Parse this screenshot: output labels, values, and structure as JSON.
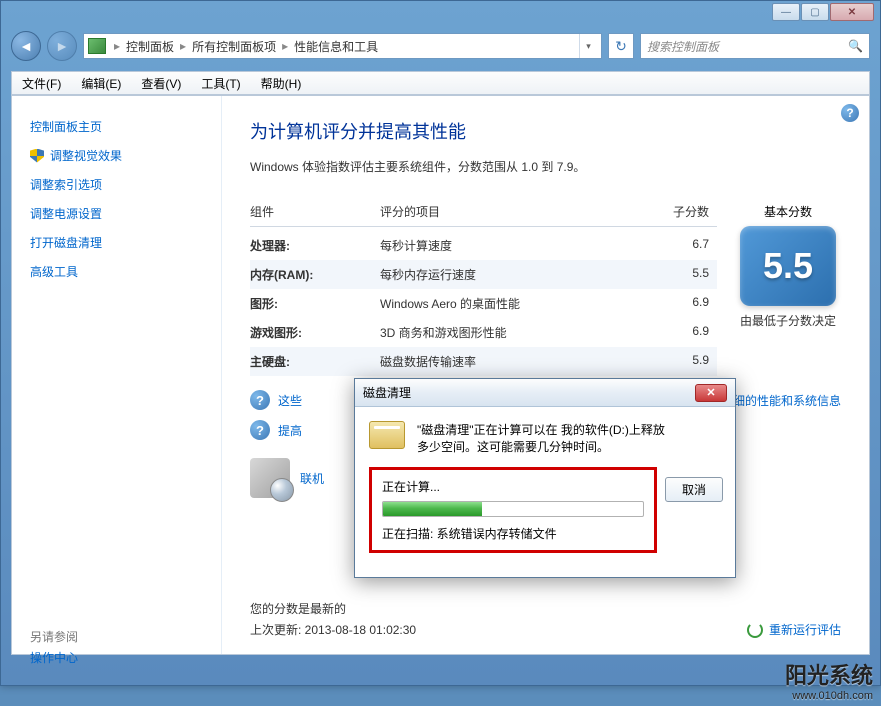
{
  "title_controls": {
    "min": "—",
    "max": "▢",
    "close": "✕"
  },
  "nav": {
    "back": "◄",
    "forward": "►"
  },
  "breadcrumbs": {
    "sep": "▸",
    "items": [
      "控制面板",
      "所有控制面板项",
      "性能信息和工具"
    ],
    "dd": "▾"
  },
  "refresh": "↻",
  "search": {
    "placeholder": "搜索控制面板",
    "icon": "🔍"
  },
  "menu": [
    "文件(F)",
    "编辑(E)",
    "查看(V)",
    "工具(T)",
    "帮助(H)"
  ],
  "sidebar": {
    "items": [
      {
        "text": "控制面板主页",
        "shield": false
      },
      {
        "text": "调整视觉效果",
        "shield": true
      },
      {
        "text": "调整索引选项",
        "shield": false
      },
      {
        "text": "调整电源设置",
        "shield": false
      },
      {
        "text": "打开磁盘清理",
        "shield": false
      },
      {
        "text": "高级工具",
        "shield": false
      }
    ],
    "see_also_head": "另请参阅",
    "see_also": "操作中心"
  },
  "main": {
    "title": "为计算机评分并提高其性能",
    "desc": "Windows 体验指数评估主要系统组件，分数范围从 1.0 到 7.9。",
    "headers": {
      "c1": "组件",
      "c2": "评分的项目",
      "c3": "子分数",
      "badge": "基本分数"
    },
    "rows": [
      {
        "c1": "处理器:",
        "c2": "每秒计算速度",
        "c3": "6.7"
      },
      {
        "c1": "内存(RAM):",
        "c2": "每秒内存运行速度",
        "c3": "5.5"
      },
      {
        "c1": "图形:",
        "c2": "Windows Aero 的桌面性能",
        "c3": "6.9"
      },
      {
        "c1": "游戏图形:",
        "c2": "3D 商务和游戏图形性能",
        "c3": "6.9"
      },
      {
        "c1": "主硬盘:",
        "c2": "磁盘数据传输速率",
        "c3": "5.9"
      }
    ],
    "badge_score": "5.5",
    "badge_caption": "由最低子分数决定",
    "help": {
      "q": "?",
      "h1_pre": "这些",
      "h1_link_right": "细的性能和系统信息",
      "h2_pre": "提高"
    },
    "learn_link": "联机",
    "bottom": {
      "line1": "您的分数是最新的",
      "line2": "上次更新: 2013-08-18 01:02:30",
      "rerun": "重新运行评估"
    }
  },
  "dialog": {
    "title": "磁盘清理",
    "close": "✕",
    "msg_l1": "\"磁盘清理\"正在计算可以在 我的软件(D:)上释放",
    "msg_l2": "多少空间。这可能需要几分钟时间。",
    "calc": "正在计算...",
    "scan": "正在扫描:  系统错误内存转储文件",
    "cancel": "取消"
  },
  "watermark": {
    "l1": "阳光系统",
    "l2": "www.010dh.com"
  }
}
